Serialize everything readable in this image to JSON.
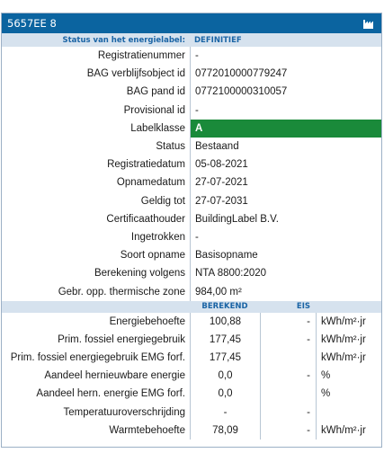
{
  "title": "5657EE 8",
  "status_section": {
    "label": "Status van het energielabel:",
    "value": "DEFINITIEF"
  },
  "fields": [
    {
      "key": "Registratienummer",
      "value": "-"
    },
    {
      "key": "BAG verblijfsobject id",
      "value": "0772010000779247"
    },
    {
      "key": "BAG pand id",
      "value": "0772100000310057"
    },
    {
      "key": "Provisional id",
      "value": "-"
    },
    {
      "key": "Labelklasse",
      "value": "A"
    },
    {
      "key": "Status",
      "value": "Bestaand"
    },
    {
      "key": "Registratiedatum",
      "value": "05-08-2021"
    },
    {
      "key": "Opnamedatum",
      "value": "27-07-2021"
    },
    {
      "key": "Geldig tot",
      "value": "27-07-2031"
    },
    {
      "key": "Certificaathouder",
      "value": "BuildingLabel B.V."
    },
    {
      "key": "Ingetrokken",
      "value": "-"
    },
    {
      "key": "Soort opname",
      "value": "Basisopname"
    },
    {
      "key": "Berekening volgens",
      "value": "NTA 8800:2020"
    },
    {
      "key": "Gebr. opp. thermische zone",
      "value": "984,00 m²"
    }
  ],
  "energy_headers": {
    "berekend": "BEREKEND",
    "eis": "EIS"
  },
  "energy_rows": [
    {
      "key": "Energiebehoefte",
      "berekend": "100,88",
      "eis": "-",
      "unit": "kWh/m²·jr"
    },
    {
      "key": "Prim. fossiel energiegebruik",
      "berekend": "177,45",
      "eis": "-",
      "unit": "kWh/m²·jr"
    },
    {
      "key": "Prim. fossiel energiegebruik EMG forf.",
      "berekend": "177,45",
      "eis": "",
      "unit": "kWh/m²·jr"
    },
    {
      "key": "Aandeel hernieuwbare energie",
      "berekend": "0,0",
      "eis": "-",
      "unit": "%"
    },
    {
      "key": "Aandeel hern. energie EMG forf.",
      "berekend": "0,0",
      "eis": "",
      "unit": "%"
    },
    {
      "key": "Temperatuuroverschrijding",
      "berekend": "-",
      "eis": "-",
      "unit": ""
    },
    {
      "key": "Warmtebehoefte",
      "berekend": "78,09",
      "eis": "-",
      "unit": "kWh/m²·jr"
    }
  ],
  "colors": {
    "titlebar": "#0b64a0",
    "section": "#d6e2ee",
    "label_a": "#1a8a3a"
  },
  "icons": {
    "title_icon": "factory-icon"
  }
}
